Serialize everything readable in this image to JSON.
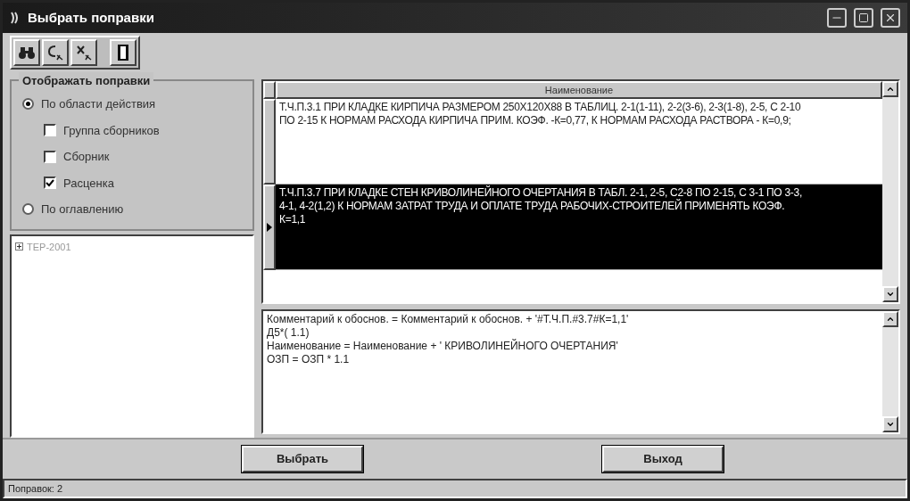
{
  "window": {
    "title": "Выбрать поправки"
  },
  "group": {
    "title": "Отображать поправки",
    "options": [
      {
        "kind": "radio",
        "label": "По области действия",
        "selected": true,
        "children": [
          {
            "kind": "checkbox",
            "label": "Группа сборников",
            "checked": false
          },
          {
            "kind": "checkbox",
            "label": "Сборник",
            "checked": false
          },
          {
            "kind": "checkbox",
            "label": "Расценка",
            "checked": true
          }
        ]
      },
      {
        "kind": "radio",
        "label": "По оглавлению",
        "selected": false
      }
    ]
  },
  "tree": {
    "items": [
      {
        "label": "ТЕР-2001",
        "expanded": false
      }
    ]
  },
  "grid": {
    "columns": [
      "Наименование"
    ],
    "rows": [
      {
        "text": "Т.Ч.П.3.1 ПРИ КЛАДКЕ КИРПИЧА РАЗМЕРОМ 250Х120Х88 В ТАБЛИЦ. 2-1(1-11), 2-2(3-6), 2-3(1-8), 2-5, С 2-10 ПО 2-15 К НОРМАМ РАСХОДА КИРПИЧА ПРИМ. КОЭФ. -К=0,77, К НОРМАМ РАСХОДА РАСТВОРА - К=0,9;",
        "selected": false
      },
      {
        "text": "Т.Ч.П.3.7 ПРИ КЛАДКЕ СТЕН КРИВОЛИНЕЙНОГО ОЧЕРТАНИЯ В ТАБЛ. 2-1, 2-5, С2-8 ПО 2-15, С 3-1 ПО 3-3, 4-1, 4-2(1,2) К НОРМАМ ЗАТРАТ ТРУДА И ОПЛАТЕ ТРУДА РАБОЧИХ-СТРОИТЕЛЕЙ ПРИМЕНЯТЬ КОЭФ. К=1,1",
        "selected": true
      }
    ]
  },
  "memo": {
    "lines": [
      "Комментарий к обоснов. = Комментарий к обоснов. + '#Т.Ч.П.#3.7#К=1,1'",
      "Д5*( 1.1)",
      "Наименование = Наименование + ' КРИВОЛИНЕЙНОГО ОЧЕРТАНИЯ'",
      "ОЗП = ОЗП * 1.1"
    ]
  },
  "buttons": [
    "Выбрать",
    "Выход"
  ],
  "status_bar": "Поправок: 2"
}
